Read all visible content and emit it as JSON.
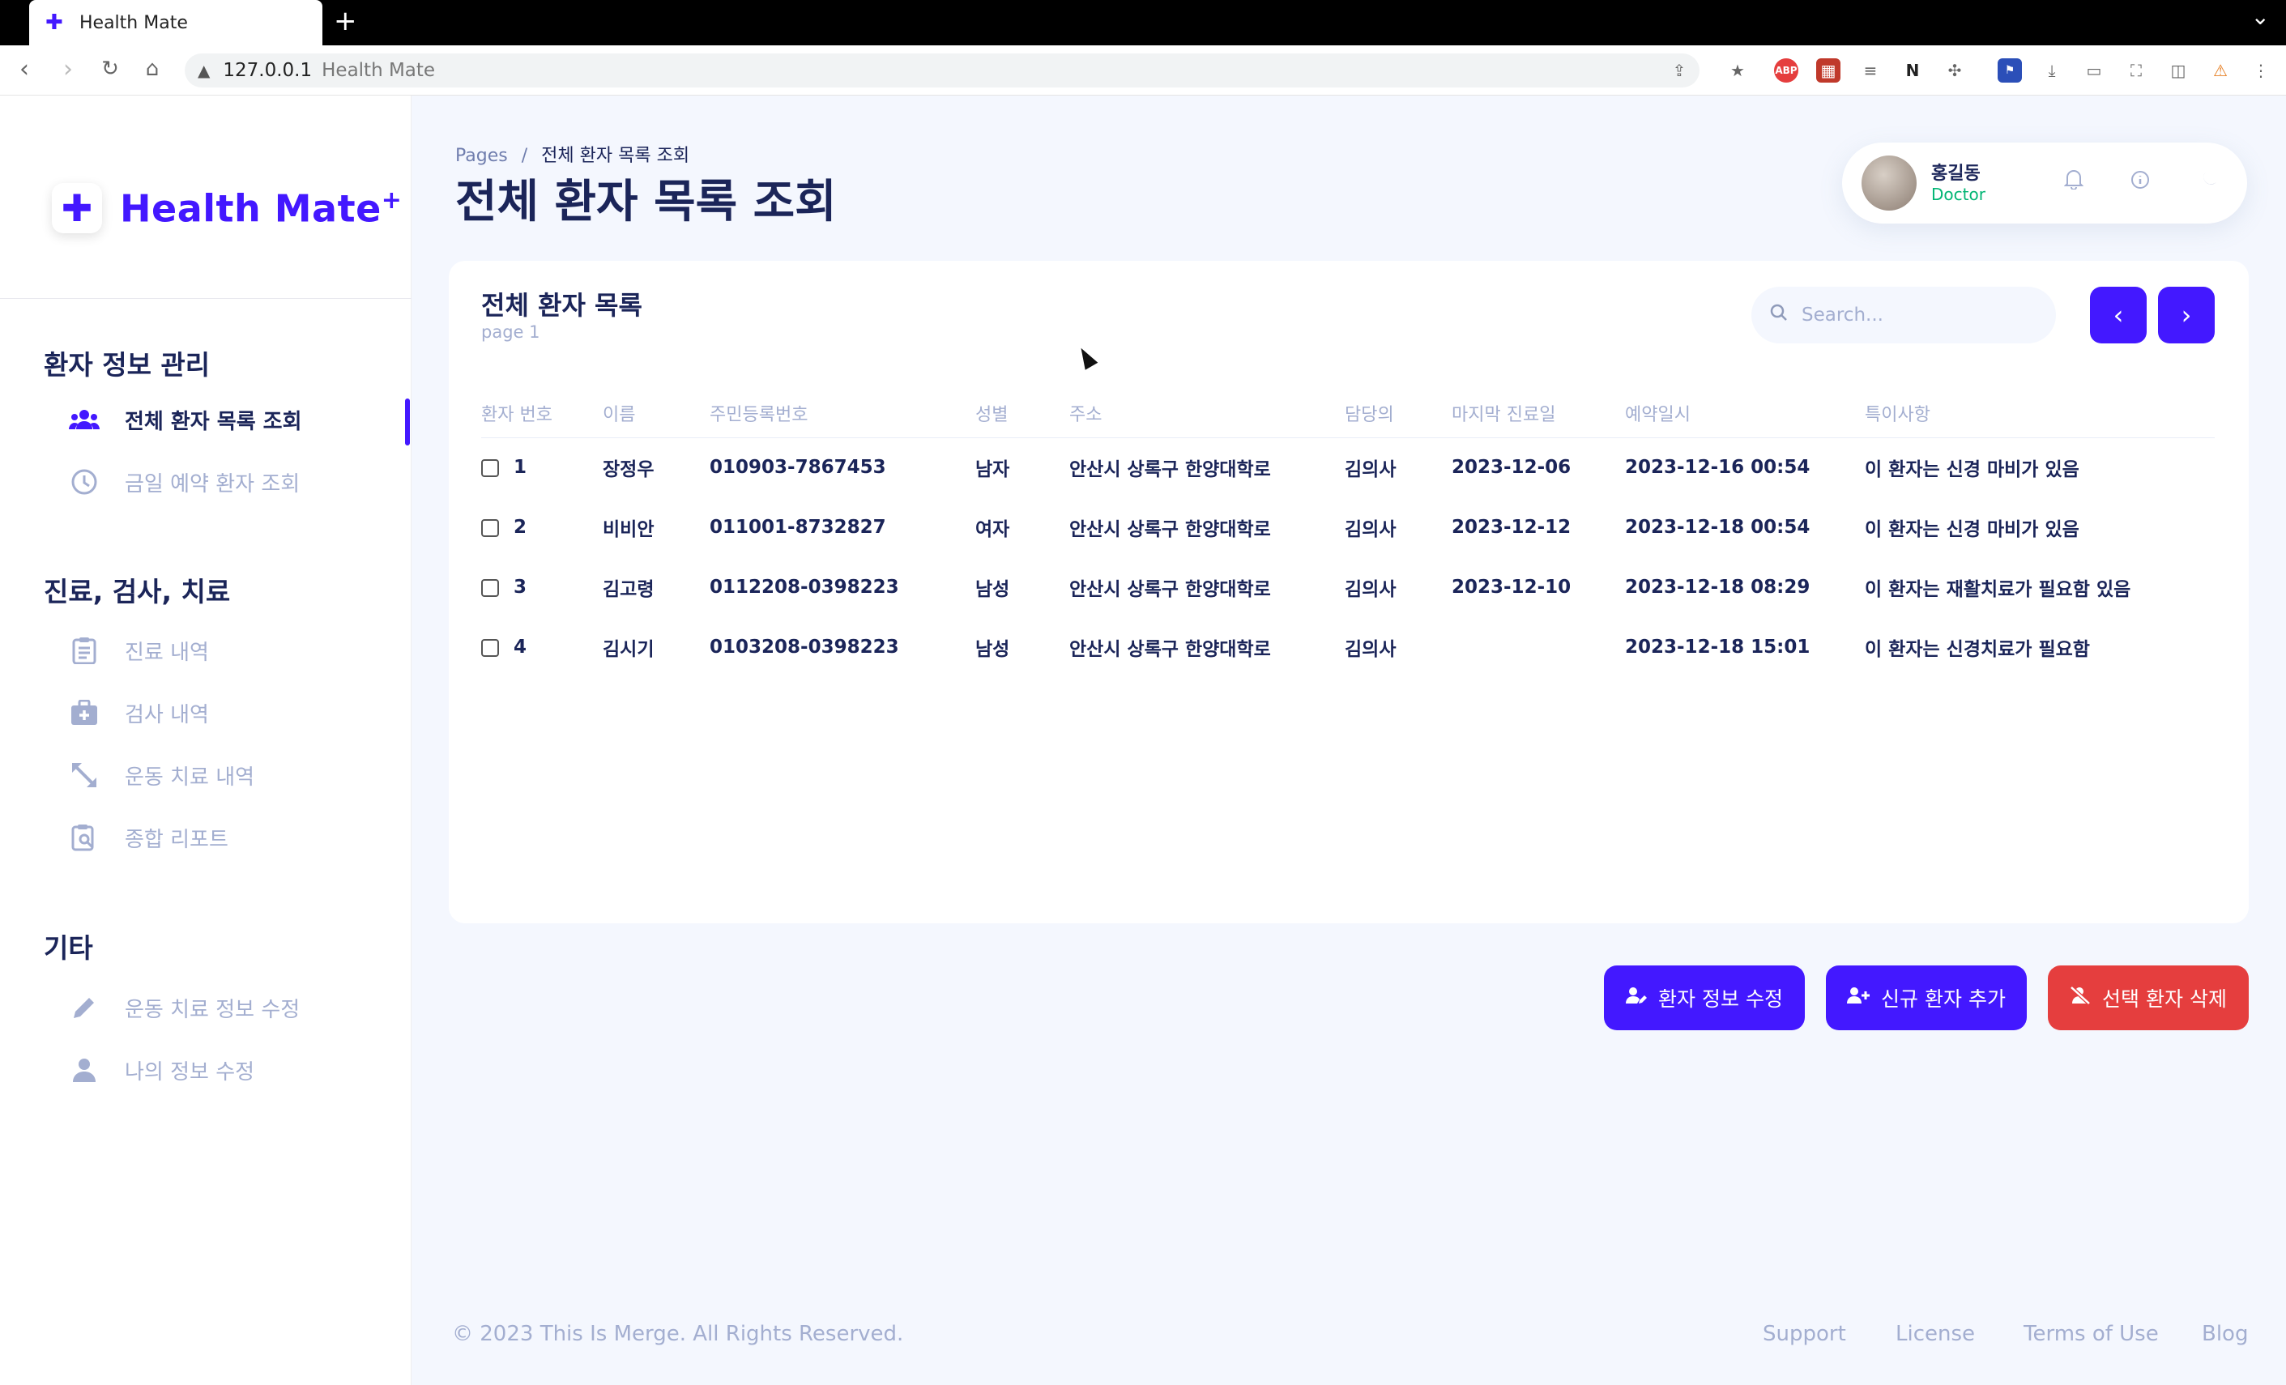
{
  "browser": {
    "tab_title": "Health Mate",
    "url_host": "127.0.0.1",
    "url_title": "Health Mate"
  },
  "sidebar": {
    "logo": "Health Mate",
    "logo_sup": "+",
    "sections": [
      {
        "title": "환자 정보 관리",
        "items": [
          {
            "label": "전체 환자 목록 조회",
            "icon": "users-icon",
            "active": true
          },
          {
            "label": "금일 예약 환자 조회",
            "icon": "clock-icon",
            "active": false
          }
        ]
      },
      {
        "title": "진료, 검사, 치료",
        "items": [
          {
            "label": "진료 내역",
            "icon": "clipboard-icon",
            "active": false
          },
          {
            "label": "검사 내역",
            "icon": "medical-kit-icon",
            "active": false
          },
          {
            "label": "운동 치료 내역",
            "icon": "resize-icon",
            "active": false
          },
          {
            "label": "종합 리포트",
            "icon": "report-search-icon",
            "active": false
          }
        ]
      },
      {
        "title": "기타",
        "items": [
          {
            "label": "운동 치료 정보 수정",
            "icon": "pencil-icon",
            "active": false
          },
          {
            "label": "나의 정보 수정",
            "icon": "person-icon",
            "active": false
          }
        ]
      }
    ]
  },
  "header": {
    "breadcrumb_root": "Pages",
    "breadcrumb_sep": "/",
    "breadcrumb_current": "전체 환자 목록 조회",
    "title": "전체 환자 목록 조회",
    "user_name": "홍길동",
    "user_role": "Doctor"
  },
  "card": {
    "title": "전체 환자 목록",
    "subtitle": "page 1",
    "search_placeholder": "Search...",
    "prev_label": "‹",
    "next_label": "›",
    "columns": [
      "환자 번호",
      "이름",
      "주민등록번호",
      "성별",
      "주소",
      "담당의",
      "마지막 진료일",
      "예약일시",
      "특이사항"
    ],
    "rows": [
      {
        "no": "1",
        "name": "장정우",
        "rrn": "010903-7867453",
        "sex": "남자",
        "addr": "안산시 상록구 한양대학로",
        "doctor": "김의사",
        "last": "2023-12-06",
        "reserve": "2023-12-16 00:54",
        "note": "이 환자는 신경 마비가 있음"
      },
      {
        "no": "2",
        "name": "비비안",
        "rrn": "011001-8732827",
        "sex": "여자",
        "addr": "안산시 상록구 한양대학로",
        "doctor": "김의사",
        "last": "2023-12-12",
        "reserve": "2023-12-18 00:54",
        "note": "이 환자는 신경 마비가 있음"
      },
      {
        "no": "3",
        "name": "김고령",
        "rrn": "0112208-0398223",
        "sex": "남성",
        "addr": "안산시 상록구 한양대학로",
        "doctor": "김의사",
        "last": "2023-12-10",
        "reserve": "2023-12-18 08:29",
        "note": "이 환자는 재활치료가 필요함 있음"
      },
      {
        "no": "4",
        "name": "김시기",
        "rrn": "0103208-0398223",
        "sex": "남성",
        "addr": "안산시 상록구 한양대학로",
        "doctor": "김의사",
        "last": "",
        "reserve": "2023-12-18 15:01",
        "note": "이 환자는 신경치료가 필요함"
      }
    ]
  },
  "actions": {
    "edit_label": "환자 정보 수정",
    "add_label": "신규 환자 추가",
    "delete_label": "선택 환자 삭제"
  },
  "footer": {
    "copyright": "© 2023 This Is Merge. All Rights Reserved.",
    "links": [
      "Support",
      "License",
      "Terms of Use",
      "Blog"
    ]
  },
  "colors": {
    "accent": "#4318ff",
    "danger": "#e53e3e",
    "text": "#1b2559",
    "muted": "#a3aed0"
  }
}
